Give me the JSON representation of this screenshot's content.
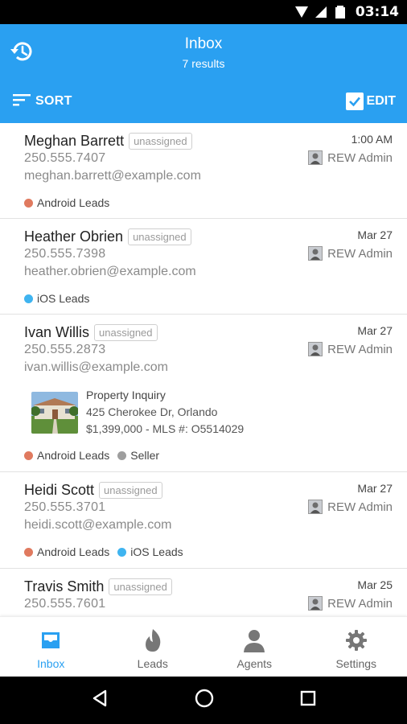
{
  "status_bar": {
    "time": "03:14"
  },
  "app_bar": {
    "title": "Inbox",
    "subtitle": "7 results",
    "sort_label": "SORT",
    "edit_label": "EDIT",
    "accent_color": "#2aa0f1"
  },
  "leads": [
    {
      "name": "Meghan Barrett",
      "badge": "unassigned",
      "phone": "250.555.7407",
      "email": "meghan.barrett@example.com",
      "date": "1:00 AM",
      "agent": "REW Admin",
      "tags": [
        {
          "label": "Android Leads",
          "color": "#e07a5f"
        }
      ]
    },
    {
      "name": "Heather Obrien",
      "badge": "unassigned",
      "phone": "250.555.7398",
      "email": "heather.obrien@example.com",
      "date": "Mar 27",
      "agent": "REW Admin",
      "tags": [
        {
          "label": "iOS Leads",
          "color": "#3fb4f0"
        }
      ]
    },
    {
      "name": "Ivan Willis",
      "badge": "unassigned",
      "phone": "250.555.2873",
      "email": "ivan.willis@example.com",
      "date": "Mar 27",
      "agent": "REW Admin",
      "inquiry": {
        "title": "Property Inquiry",
        "address": "425 Cherokee Dr, Orlando",
        "details": "$1,399,000 - MLS #: O5514029"
      },
      "tags": [
        {
          "label": "Android Leads",
          "color": "#e07a5f"
        },
        {
          "label": "Seller",
          "color": "#9e9e9e"
        }
      ]
    },
    {
      "name": "Heidi Scott",
      "badge": "unassigned",
      "phone": "250.555.3701",
      "email": "heidi.scott@example.com",
      "date": "Mar 27",
      "agent": "REW Admin",
      "tags": [
        {
          "label": "Android Leads",
          "color": "#e07a5f"
        },
        {
          "label": "iOS Leads",
          "color": "#3fb4f0"
        }
      ]
    },
    {
      "name": "Travis Smith",
      "badge": "unassigned",
      "phone": "250.555.7601",
      "date": "Mar 25",
      "agent": "REW Admin"
    }
  ],
  "bottom_nav": {
    "items": [
      {
        "label": "Inbox",
        "icon": "inbox-icon",
        "active": true
      },
      {
        "label": "Leads",
        "icon": "flame-icon",
        "active": false
      },
      {
        "label": "Agents",
        "icon": "person-icon",
        "active": false
      },
      {
        "label": "Settings",
        "icon": "gear-icon",
        "active": false
      }
    ]
  },
  "system_nav": {
    "icons": [
      "back-icon",
      "home-icon",
      "recents-icon"
    ]
  }
}
